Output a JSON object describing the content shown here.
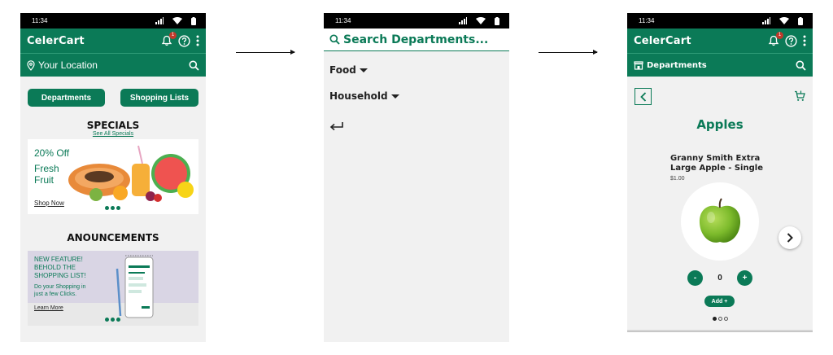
{
  "colors": {
    "brand": "#0b7a57",
    "background": "#f1f1f1",
    "badge": "#c0392b"
  },
  "status": {
    "time": "11:34"
  },
  "app": {
    "name": "CelerCart",
    "notification_count": "1"
  },
  "home": {
    "location_placeholder": "Your Location",
    "buttons": {
      "departments": "Departments",
      "shopping_lists": "Shopping Lists"
    },
    "specials": {
      "title": "SPECIALS",
      "link": "See All Specials",
      "promo": {
        "discount": "20% Off",
        "line1": "Fresh",
        "line2": "Fruit",
        "cta": "Shop Now"
      }
    },
    "announcements": {
      "title": "ANOUNCEMENTS",
      "feature": {
        "line1": "NEW FEATURE!",
        "line2": "BEHOLD THE",
        "line3": "SHOPPING LIST!",
        "sub1": "Do your Shopping in",
        "sub2": "just a few Clicks.",
        "cta": "Learn More"
      }
    }
  },
  "departments_menu": {
    "search_label": "Search Departments...",
    "items": [
      {
        "label": "Food"
      },
      {
        "label": "Household"
      }
    ]
  },
  "product_page": {
    "nav_label": "Departments",
    "category": "Apples",
    "product": {
      "name": "Granny Smith Extra Large Apple - Single",
      "price": "$1.00"
    },
    "quantity": "0",
    "minus": "-",
    "plus": "+",
    "add_label": "Add +",
    "pager": {
      "current": 1,
      "total": 3
    }
  }
}
